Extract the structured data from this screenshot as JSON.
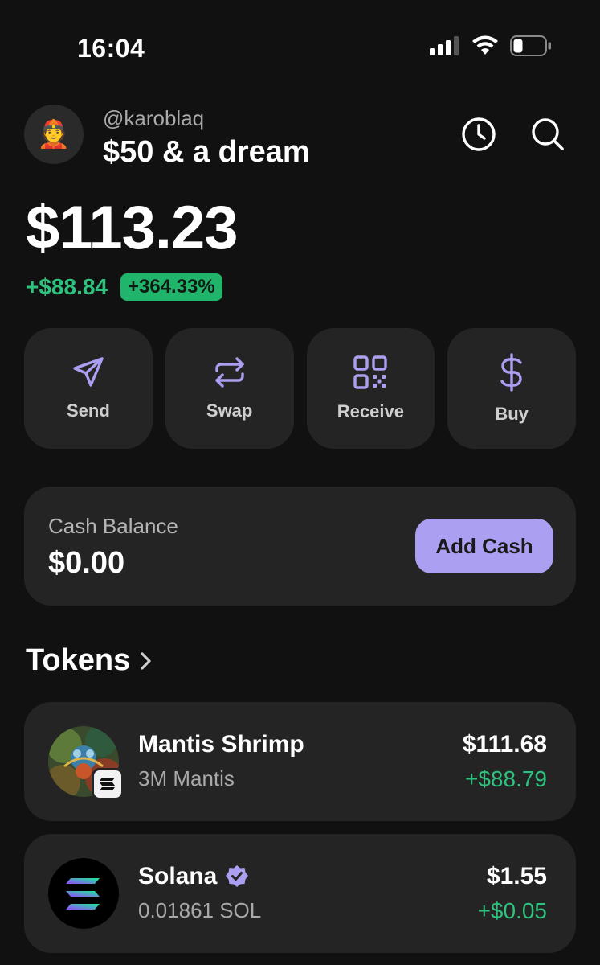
{
  "status_bar": {
    "time": "16:04"
  },
  "header": {
    "username": "@karoblaq",
    "wallet_name": "$50 & a dream",
    "avatar_emoji": "👲"
  },
  "portfolio": {
    "balance": "$113.23",
    "change_amount": "+$88.84",
    "change_percent": "+364.33%"
  },
  "actions": [
    {
      "label": "Send",
      "icon": "send-icon"
    },
    {
      "label": "Swap",
      "icon": "swap-icon"
    },
    {
      "label": "Receive",
      "icon": "qr-code-icon"
    },
    {
      "label": "Buy",
      "icon": "dollar-icon"
    }
  ],
  "cash": {
    "label": "Cash Balance",
    "value": "$0.00",
    "button_label": "Add Cash"
  },
  "tokens_section": {
    "title": "Tokens"
  },
  "tokens": [
    {
      "name": "Mantis Shrimp",
      "amount": "3M Mantis",
      "value": "$111.68",
      "change": "+$88.79",
      "verified": false
    },
    {
      "name": "Solana",
      "amount": "0.01861 SOL",
      "value": "$1.55",
      "change": "+$0.05",
      "verified": true
    }
  ],
  "colors": {
    "accent": "#ab9ff2",
    "positive": "#2ec27e",
    "card": "#242424",
    "background": "#111111"
  }
}
